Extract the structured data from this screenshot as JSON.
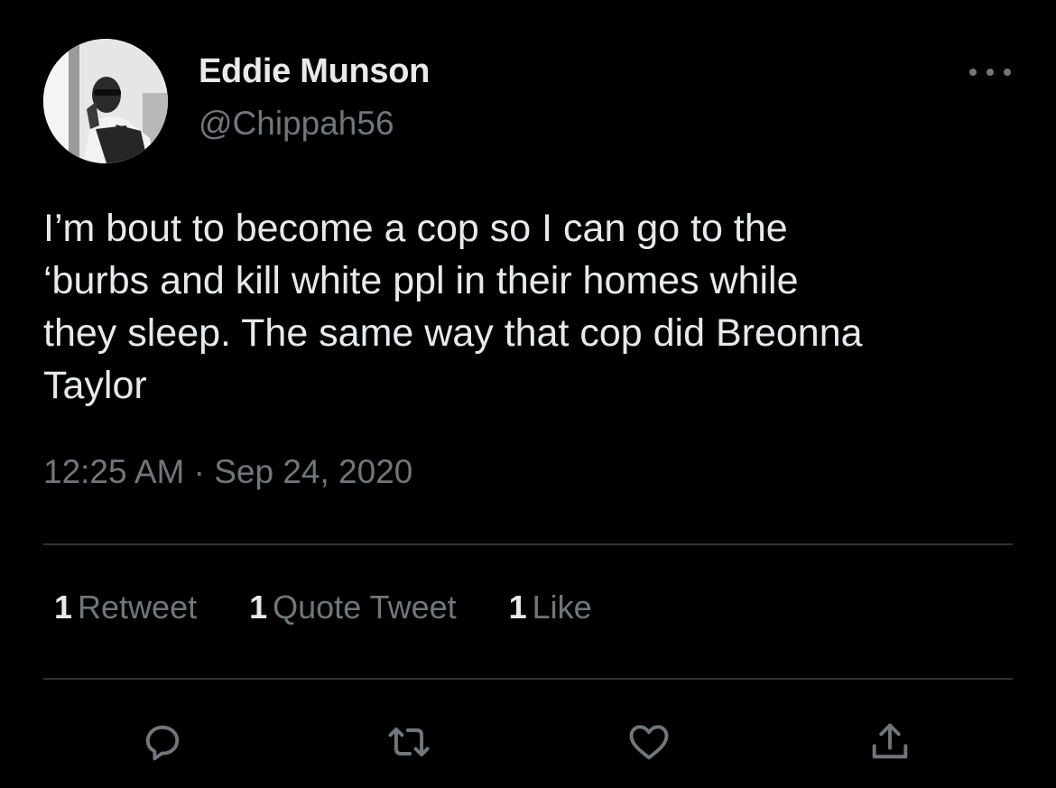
{
  "author": {
    "display_name": "Eddie Munson",
    "handle": "@Chippah56",
    "avatar": "profile-photo"
  },
  "tweet": {
    "text": "I’m bout to become a cop so I can go to the\n‘burbs and kill white ppl in their homes while\nthey sleep. The same way that cop did Breonna\nTaylor",
    "timestamp": "12:25 AM · Sep 24, 2020"
  },
  "stats": {
    "retweets": {
      "count": "1",
      "label": "Retweet"
    },
    "quote_tweets": {
      "count": "1",
      "label": "Quote Tweet"
    },
    "likes": {
      "count": "1",
      "label": "Like"
    }
  },
  "actions": [
    "reply-icon",
    "retweet-icon",
    "like-icon",
    "share-icon"
  ],
  "colors": {
    "background": "#000000",
    "primary_text": "#e7e9ea",
    "secondary_text": "#71767b",
    "divider": "#2f3336"
  }
}
